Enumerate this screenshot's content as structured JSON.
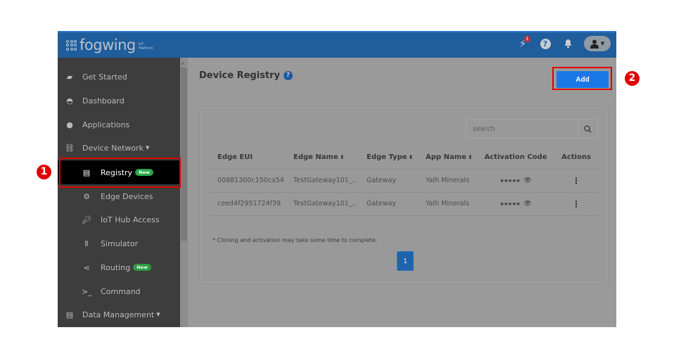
{
  "topbar": {
    "logo_text": "fogwing",
    "logo_sub_line1": "IoT",
    "logo_sub_line2": "Platform",
    "notification_badge": "1",
    "help_glyph": "?"
  },
  "sidebar": {
    "items": [
      {
        "label": "Get Started",
        "icon": "rocket-icon"
      },
      {
        "label": "Dashboard",
        "icon": "gauge-icon"
      },
      {
        "label": "Applications",
        "icon": "apps-icon"
      },
      {
        "label": "Device Network",
        "icon": "network-icon"
      },
      {
        "label": "Registry",
        "icon": "id-card-icon",
        "badge": "New"
      },
      {
        "label": "Edge Devices",
        "icon": "cogs-icon"
      },
      {
        "label": "IoT Hub Access",
        "icon": "key-icon"
      },
      {
        "label": "Simulator",
        "icon": "simulator-icon"
      },
      {
        "label": "Routing",
        "icon": "share-icon",
        "badge": "New"
      },
      {
        "label": "Command",
        "icon": "terminal-icon"
      },
      {
        "label": "Data Management",
        "icon": "database-icon"
      }
    ]
  },
  "main": {
    "title": "Device Registry",
    "add_label": "Add",
    "search_placeholder": "search",
    "table": {
      "columns": [
        "Edge EUI",
        "Edge Name",
        "Edge Type",
        "App Name",
        "Activation Code",
        "Actions"
      ],
      "rows": [
        {
          "eui": "00881300c150ca54",
          "name": "TestGateway101_..",
          "type": "Gateway",
          "app": "Yalh Minerals",
          "code": "★★★★★"
        },
        {
          "eui": "ceed4f2951724f39",
          "name": "TestGateway101_..",
          "type": "Gateway",
          "app": "Yalh Minerals",
          "code": "★★★★★"
        }
      ]
    },
    "note": "* Cloning and activation may take some time to complete.",
    "pagination": {
      "current_page": "1"
    }
  },
  "annotations": {
    "marker1": "1",
    "marker2": "2",
    "color": "#e00000"
  },
  "colors": {
    "topbar": "#1f5d9c",
    "sidebar": "#3d3d3d",
    "accent_button": "#1a78e6",
    "new_badge": "#28a745"
  }
}
